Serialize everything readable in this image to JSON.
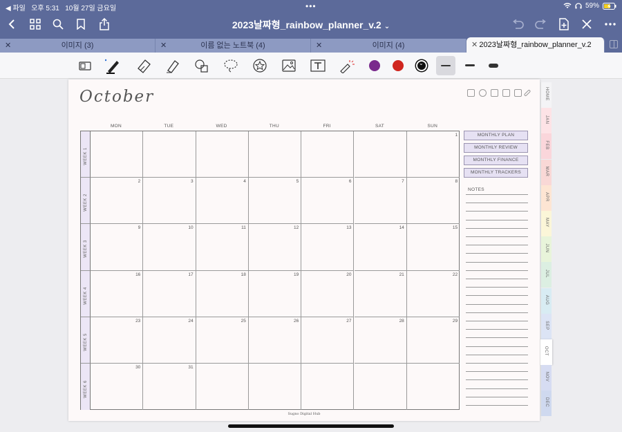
{
  "status": {
    "back_label": "◀ 파일",
    "time": "오후 5:31",
    "date": "10월 27일 금요일",
    "battery": "59%"
  },
  "titlebar": {
    "title": "2023날짜형_rainbow_planner_v.2"
  },
  "tabs": [
    {
      "label": "이미지 (3)"
    },
    {
      "label": "이름 없는 노트북 (4)"
    },
    {
      "label": "이미지 (4)"
    },
    {
      "label": "2023날짜형_rainbow_planner_v.2"
    }
  ],
  "toolbar": {
    "colors": [
      "#7a2a8c",
      "#d0261f",
      "#111111"
    ]
  },
  "planner": {
    "month_title": "October",
    "days": [
      "MON",
      "TUE",
      "WED",
      "THU",
      "FRI",
      "SAT",
      "SUN"
    ],
    "weeks": [
      {
        "label": "WEEK 1",
        "dates": [
          "",
          "",
          "",
          "",
          "",
          "",
          "1"
        ]
      },
      {
        "label": "WEEK 2",
        "dates": [
          "2",
          "3",
          "4",
          "5",
          "6",
          "7",
          "8"
        ]
      },
      {
        "label": "WEEK 3",
        "dates": [
          "9",
          "10",
          "11",
          "12",
          "13",
          "14",
          "15"
        ]
      },
      {
        "label": "WEEK 4",
        "dates": [
          "16",
          "17",
          "18",
          "19",
          "20",
          "21",
          "22"
        ]
      },
      {
        "label": "WEEK 5",
        "dates": [
          "23",
          "24",
          "25",
          "26",
          "27",
          "28",
          "29"
        ]
      },
      {
        "label": "WEEK 6",
        "dates": [
          "30",
          "31",
          "",
          "",
          "",
          "",
          ""
        ]
      }
    ],
    "side_buttons": [
      "MONTHLY PLAN",
      "MONTHLY REVIEW",
      "MONTHLY FINANCE",
      "MONTHLY TRACKERS"
    ],
    "notes_label": "NOTES",
    "footer": "Sugno Digital Hub"
  },
  "month_tabs": [
    {
      "label": "HOME",
      "color": "#f4f4f6"
    },
    {
      "label": "JAN",
      "color": "#fde3e6"
    },
    {
      "label": "FEB",
      "color": "#fad6db"
    },
    {
      "label": "MAR",
      "color": "#f9d8d6"
    },
    {
      "label": "APR",
      "color": "#fde5d3"
    },
    {
      "label": "MAY",
      "color": "#fbf6d8"
    },
    {
      "label": "JUN",
      "color": "#e8f4da"
    },
    {
      "label": "JUL",
      "color": "#dcefe2"
    },
    {
      "label": "AUG",
      "color": "#d8ecf3"
    },
    {
      "label": "SEP",
      "color": "#dce4f5"
    },
    {
      "label": "OCT",
      "color": "#ffffff"
    },
    {
      "label": "NOV",
      "color": "#d6dcf2"
    },
    {
      "label": "DEC",
      "color": "#cfd9ef"
    }
  ]
}
